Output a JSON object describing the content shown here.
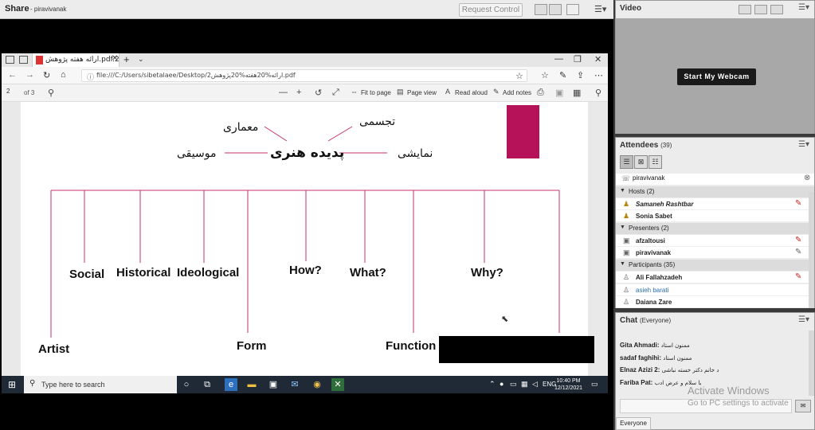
{
  "share": {
    "title": "Share",
    "presenter": "- piravivanak",
    "request_control": "Request Control",
    "menu_icon": "hamburger-menu-icon"
  },
  "browser": {
    "tab_title": "ارائه هفته پژوهش.pdf.2",
    "url": "file:///C:/Users/sibetalaee/Desktop/2ارائه%20هفته%20پژوهش.pdf",
    "page_current": "2",
    "page_of": "of 3",
    "fit_to_page": "Fit to page",
    "page_view": "Page view",
    "read_aloud": "Read aloud",
    "add_notes": "Add notes"
  },
  "slide": {
    "center": "پدیده هنری",
    "left_top": "معماری",
    "left": "موسیقی",
    "right_top": "تجسمی",
    "right": "نمایشی",
    "social": "Social",
    "historical": "Historical",
    "ideological": "Ideological",
    "how": "How?",
    "what": "What?",
    "why": "Why?",
    "artist": "Artist",
    "form": "Form",
    "function": "Function",
    "accent_color": "#b5125a",
    "line_color": "#c8326e"
  },
  "taskbar": {
    "search_placeholder": "Type here to search",
    "lang": "ENG",
    "time": "10:40 PM",
    "date": "12/12/2021"
  },
  "video": {
    "title": "Video",
    "webcam_button": "Start My Webcam"
  },
  "attendees": {
    "title": "Attendees",
    "count": "(39)",
    "me": "piravivanak",
    "hosts_label": "Hosts (2)",
    "hosts": [
      "Samaneh Rashtbar",
      "Sonia Sabet"
    ],
    "presenters_label": "Presenters (2)",
    "presenters": [
      "afzaltousi",
      "piravivanak"
    ],
    "participants_label": "Participants (35)",
    "participants": [
      "Ali Fallahzadeh",
      "asieh barati",
      "Daiana Zare"
    ]
  },
  "chat": {
    "title": "Chat",
    "scope": "(Everyone)",
    "messages": [
      {
        "name": "Gita Ahmadi:",
        "text": "ممنون استاد"
      },
      {
        "name": "sadaf faghihi:",
        "text": "ممنون استاد"
      },
      {
        "name": "Elnaz Azizi 2:",
        "text": "د خانم دکتر خسته نباشی"
      },
      {
        "name": "Fariba Pat:",
        "text": "با سلام و عرض ادب"
      }
    ],
    "watermark_1": "Activate Windows",
    "watermark_2": "Go to PC settings to activate",
    "recipient": "Everyone"
  }
}
